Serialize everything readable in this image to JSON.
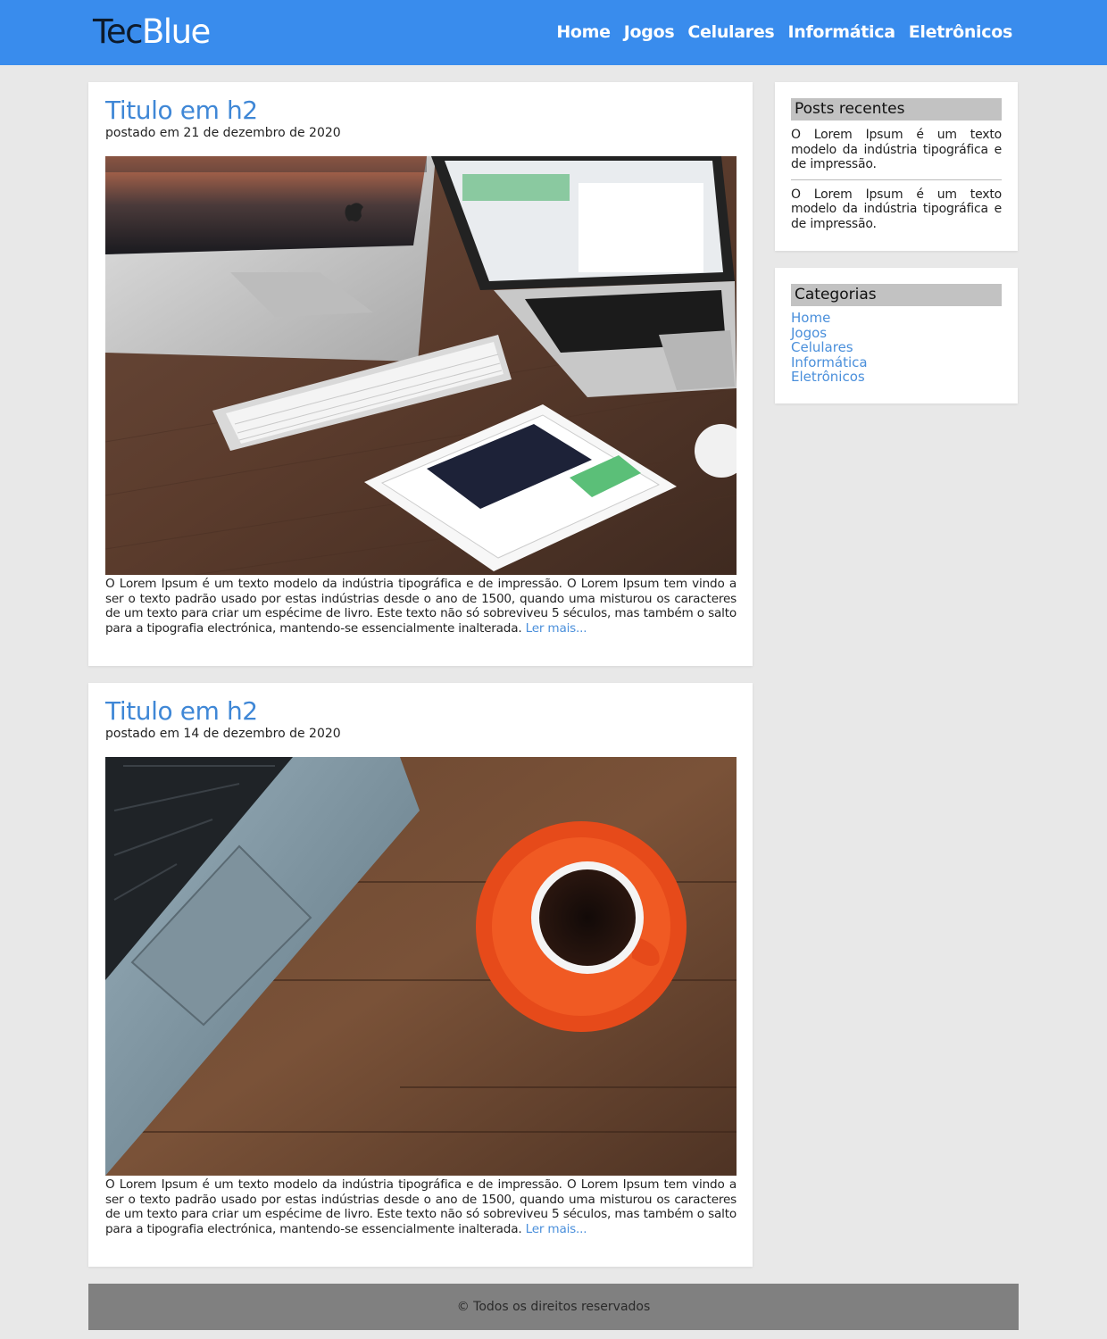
{
  "header": {
    "logo_dark": "Tec",
    "logo_light": "Blue",
    "nav": [
      "Home",
      "Jogos",
      "Celulares",
      "Informática",
      "Eletrônicos"
    ]
  },
  "posts": [
    {
      "title": "Titulo em h2",
      "date": "postado em 21 de dezembro de 2020",
      "image": "desk-devices-photo",
      "body": "O Lorem Ipsum é um texto modelo da indústria tipográfica e de impressão. O Lorem Ipsum tem vindo a ser o texto padrão usado por estas indústrias desde o ano de 1500, quando uma misturou os caracteres de um texto para criar um espécime de livro. Este texto não só sobreviveu 5 séculos, mas também o salto para a tipografia electrónica, mantendo-se essencialmente inalterada.",
      "read_more": "Ler mais..."
    },
    {
      "title": "Titulo em h2",
      "date": "postado em 14 de dezembro de 2020",
      "image": "laptop-coffee-photo",
      "body": "O Lorem Ipsum é um texto modelo da indústria tipográfica e de impressão. O Lorem Ipsum tem vindo a ser o texto padrão usado por estas indústrias desde o ano de 1500, quando uma misturou os caracteres de um texto para criar um espécime de livro. Este texto não só sobreviveu 5 séculos, mas também o salto para a tipografia electrónica, mantendo-se essencialmente inalterada.",
      "read_more": "Ler mais..."
    }
  ],
  "sidebar": {
    "recent_title": "Posts recentes",
    "recent_items": [
      "O Lorem Ipsum é um texto modelo da indústria tipográfica e de impressão.",
      "O Lorem Ipsum é um texto modelo da indústria tipográfica e de impressão."
    ],
    "categories_title": "Categorias",
    "categories": [
      "Home",
      "Jogos",
      "Celulares",
      "Informática",
      "Eletrônicos"
    ]
  },
  "footer": {
    "text": "© Todos os direitos reservados"
  },
  "colors": {
    "header_bg": "#398ced",
    "accent_link": "#4a8fdb",
    "page_bg": "#e8e8e8",
    "footer_bg": "#808080"
  }
}
